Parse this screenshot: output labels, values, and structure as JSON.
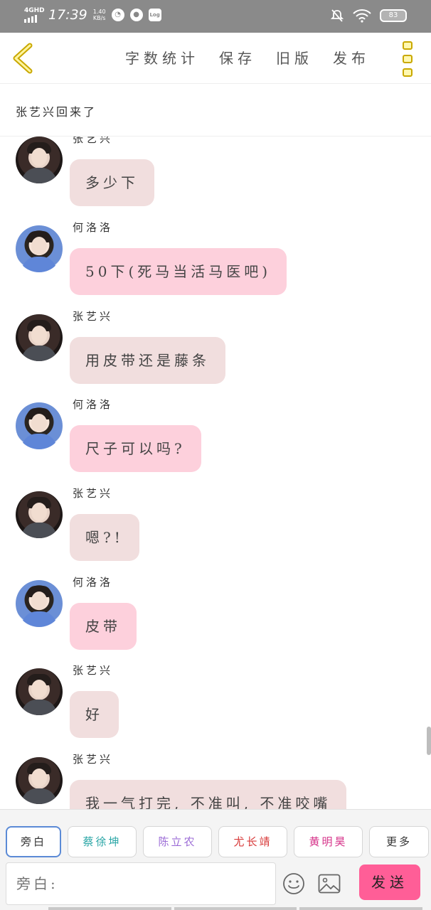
{
  "status_bar": {
    "network": "4GHD",
    "time": "17:39",
    "speed_value": "1.40",
    "speed_unit": "KB/s",
    "app_icon_label": "Log",
    "battery": "83"
  },
  "header": {
    "links": [
      "字数统计",
      "保存",
      "旧版",
      "发布"
    ]
  },
  "title": "张艺兴回来了",
  "messages": [
    {
      "speaker": "张艺兴",
      "text": "多少下",
      "side": "zhang"
    },
    {
      "speaker": "何洛洛",
      "text": "50下(死马当活马医吧)",
      "side": "he"
    },
    {
      "speaker": "张艺兴",
      "text": "用皮带还是藤条",
      "side": "zhang"
    },
    {
      "speaker": "何洛洛",
      "text": "尺子可以吗?",
      "side": "he"
    },
    {
      "speaker": "张艺兴",
      "text": "嗯?!",
      "side": "zhang"
    },
    {
      "speaker": "何洛洛",
      "text": "皮带",
      "side": "he"
    },
    {
      "speaker": "张艺兴",
      "text": "好",
      "side": "zhang"
    },
    {
      "speaker": "张艺兴",
      "text": "我一气打完, 不准叫, 不准咬嘴",
      "side": "zhang"
    }
  ],
  "characters": [
    {
      "label": "旁白",
      "color": "#333333"
    },
    {
      "label": "蔡徐坤",
      "color": "#2aa6a6"
    },
    {
      "label": "陈立农",
      "color": "#9b6bd6"
    },
    {
      "label": "尤长靖",
      "color": "#d83a3a"
    },
    {
      "label": "黄明昊",
      "color": "#d6338a"
    },
    {
      "label": "更多",
      "color": "#333333"
    }
  ],
  "composer": {
    "placeholder": "旁白:",
    "send_label": "发送"
  },
  "colors": {
    "accent_send": "#ff5e97",
    "bubble_zhang": "#f1dede",
    "bubble_he": "#fdd0dc",
    "more_menu": "#c9a800"
  }
}
